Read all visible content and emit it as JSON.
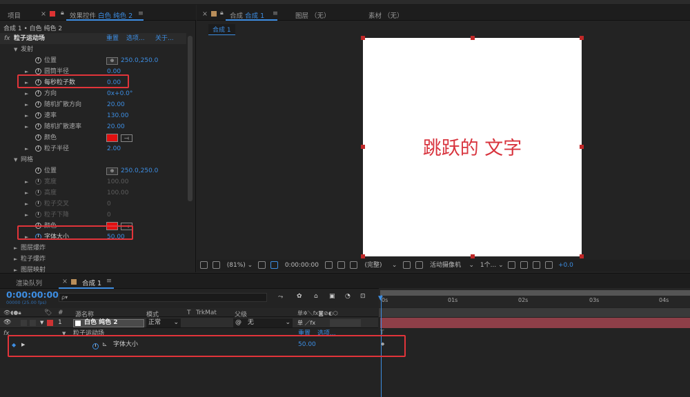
{
  "left_panel": {
    "tab_project": "项目",
    "tab_effects_prefix": "效果控件",
    "tab_effects_layer": "白色 纯色 2",
    "breadcrumb": "合成 1 • 白色 纯色 2"
  },
  "effect": {
    "fx": "fx",
    "name": "粒子运动场",
    "reset": "重置",
    "options": "选项...",
    "about": "关于..."
  },
  "emit": {
    "label": "发射",
    "position_label": "位置",
    "position_value": "250.0,250.0",
    "barrel_radius_label": "圆筒半径",
    "barrel_radius_value": "0.00",
    "particles_per_sec_label": "每秒粒子数",
    "particles_per_sec_value": "0.00",
    "direction_label": "方向",
    "direction_value": "0x+0.0°",
    "random_dir_label": "随机扩散方向",
    "random_dir_value": "20.00",
    "velocity_label": "速率",
    "velocity_value": "130.00",
    "random_vel_label": "随机扩散速率",
    "random_vel_value": "20.00",
    "color_label": "颜色",
    "particle_radius_label": "粒子半径",
    "particle_radius_value": "2.00"
  },
  "grid": {
    "label": "网格",
    "position_label": "位置",
    "position_value": "250.0,250.0",
    "width_label": "宽度",
    "width_value": "100.00",
    "height_label": "高度",
    "height_value": "100.00",
    "h_particles_label": "粒子交叉",
    "h_particles_value": "0",
    "v_particles_label": "粒子下降",
    "v_particles_value": "0",
    "color_label": "颜色",
    "font_size_label": "字体大小",
    "font_size_value": "50.00"
  },
  "sections": {
    "layer_explode": "图层爆炸",
    "particle_explode": "粒子爆炸",
    "layer_map": "图层映射"
  },
  "viewer": {
    "tab_comp_prefix": "合成",
    "tab_comp_name": "合成 1",
    "tab_layer": "图层 （无）",
    "tab_footage": "素材 （无）",
    "comp_chip": "合成 1",
    "canvas_text": "跳跃的 文字",
    "zoom": "(81%)",
    "timecode": "0:00:00:00",
    "resolution": "(完整)",
    "camera": "活动摄像机",
    "views": "1个...",
    "exposure": "+0.0"
  },
  "timeline": {
    "tab_render": "渲染队列",
    "tab_comp": "合成 1",
    "timecode": "0:00:00:00",
    "frames": "00000 (25.00 fps)",
    "search_placeholder": "ρ▾",
    "col_num": "#",
    "col_source": "源名称",
    "col_mode": "模式",
    "col_t": "T",
    "col_trkmat": "TrkMat",
    "col_parent": "父级",
    "layer_num": "1",
    "layer_name": "白色 纯色 2",
    "layer_mode": "正常",
    "layer_parent": "无",
    "effect_name": "粒子运动场",
    "effect_reset": "重置",
    "effect_options": "选项...",
    "prop_name": "字体大小",
    "prop_value": "50.00",
    "ruler": [
      "0s",
      "01s",
      "02s",
      "03s",
      "04s"
    ]
  },
  "colors": {
    "accent": "#3d8ee3",
    "highlight_box": "#e2343a",
    "particle_color": "#e01010",
    "canvas_text": "#d8343e"
  }
}
